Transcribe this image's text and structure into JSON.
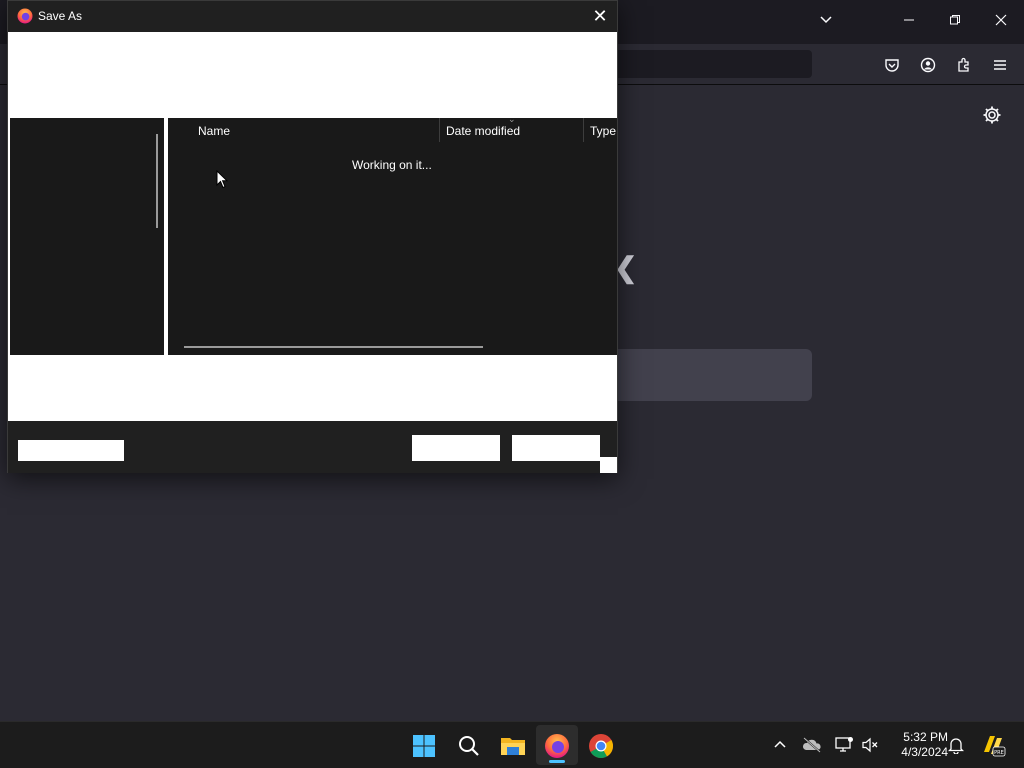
{
  "dialog": {
    "title": "Save As",
    "close_glyph": "✕",
    "columns": {
      "name": "Name",
      "date_modified": "Date modified",
      "type": "Type"
    },
    "status_text": "Working on it..."
  },
  "browser": {
    "prev_glyph": "❮"
  },
  "taskbar": {
    "time": "5:32 PM",
    "date": "4/3/2024"
  },
  "colors": {
    "accent": "#4cc2ff",
    "dialog_bg": "#191919",
    "browser_bg": "#2b2a33"
  }
}
